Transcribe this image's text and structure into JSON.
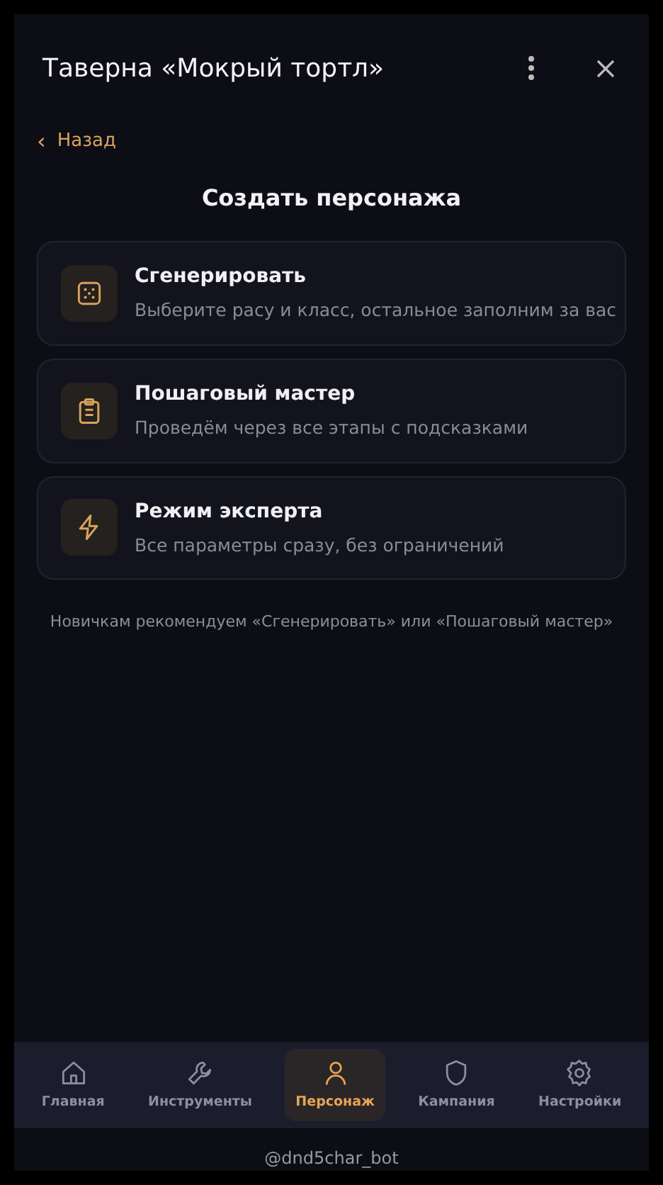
{
  "header": {
    "title": "Таверна «Мокрый тортл»"
  },
  "back_link": {
    "icon": "‹",
    "label": "Назад"
  },
  "heading": "Создать персонажа",
  "options": [
    {
      "title": "Сгенерировать",
      "description": "Выберите расу и класс, остальное заполним за вас"
    },
    {
      "title": "Пошаговый мастер",
      "description": "Проведём через все этапы с подсказками"
    },
    {
      "title": "Режим эксперта",
      "description": "Все параметры сразу, без ограничений"
    }
  ],
  "hint": "Новичкам рекомендуем «Сгенерировать» или «Пошаговый мастер»",
  "bottom_nav": [
    {
      "label": "Главная",
      "selected": false
    },
    {
      "label": "Инструменты",
      "selected": false
    },
    {
      "label": "Персонаж",
      "selected": true
    },
    {
      "label": "Кампания",
      "selected": false
    },
    {
      "label": "Настройки",
      "selected": false
    }
  ],
  "footer": "@dnd5char_bot"
}
